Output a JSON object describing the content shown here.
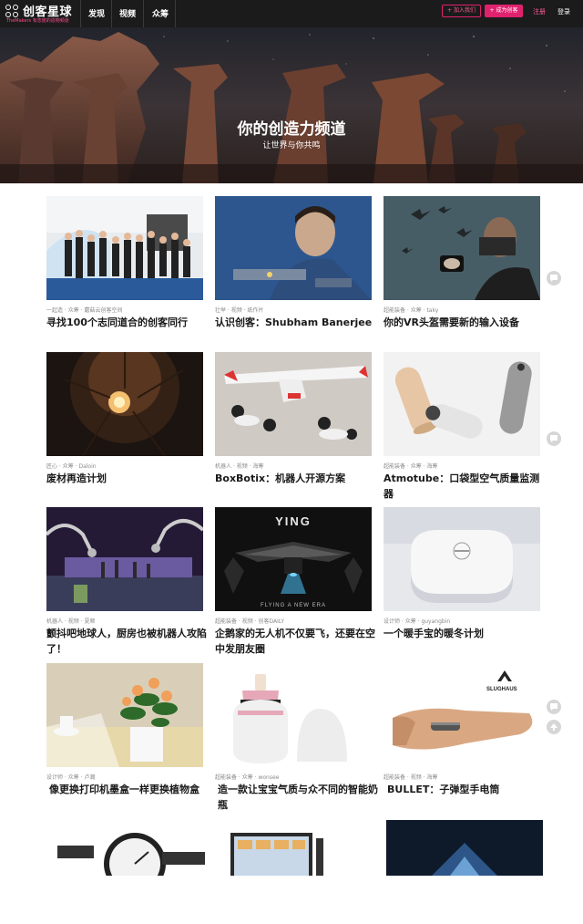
{
  "header": {
    "logo_text": "创客星球",
    "logo_sub": "TheMakers 有态度的造物频道",
    "nav": [
      "发现",
      "视频",
      "众筹"
    ],
    "join_button": "+ 加入我们",
    "creator_button": "+ 成为创客",
    "register_link": "注册",
    "login_link": "登录"
  },
  "hero": {
    "title": "你的创造力频道",
    "subtitle": "让世界与你共鸣"
  },
  "cards": [
    {
      "meta": "一起造 · 众筹 · 蘑菇云创客空间",
      "title": "寻找100个志同道合的创客同行"
    },
    {
      "meta": "壮举 · 视频 · 纸作片",
      "title": "认识创客：Shubham Banerjee"
    },
    {
      "meta": "超能装备 · 众筹 · taky",
      "title": "你的VR头盔需要新的输入设备"
    },
    {
      "meta": "匠心 · 众筹 · Daloin",
      "title": "废材再造计划"
    },
    {
      "meta": "机器人 · 视频 · 海筹",
      "title": "BoxBotix：机器人开源方案"
    },
    {
      "meta": "超能装备 · 众筹 · 海筹",
      "title": "Atmotube：口袋型空气质量监测器"
    },
    {
      "meta": "机器人 · 视频 · 夏顺",
      "title": "颤抖吧地球人，厨房也被机器人攻陷了！"
    },
    {
      "meta": "超能装备 · 视频 · 创客DAILY",
      "title": "企鹅家的无人机不仅要飞，还要在空中发朋友圈"
    },
    {
      "meta": "设计师 · 众筹 · guyangbin",
      "title": "一个暖手宝的暖冬计划"
    },
    {
      "meta": "设计师 · 众筹 · 卢瀚",
      "title": "像更换打印机墨盒一样更换植物盒"
    },
    {
      "meta": "超能装备 · 众筹 · wonsee",
      "title": "造一款让宝宝气质与众不同的智能奶瓶"
    },
    {
      "meta": "超能装备 · 视频 · 海筹",
      "title": "BULLET：子弹型手电筒"
    }
  ],
  "thumb_text": {
    "drone_brand": "YING",
    "drone_tagline": "FLYING A NEW ERA",
    "slughaus_brand": "SLUGHAUS"
  },
  "colors": {
    "accent": "#e0226e",
    "topbar": "#1b1b1b"
  }
}
